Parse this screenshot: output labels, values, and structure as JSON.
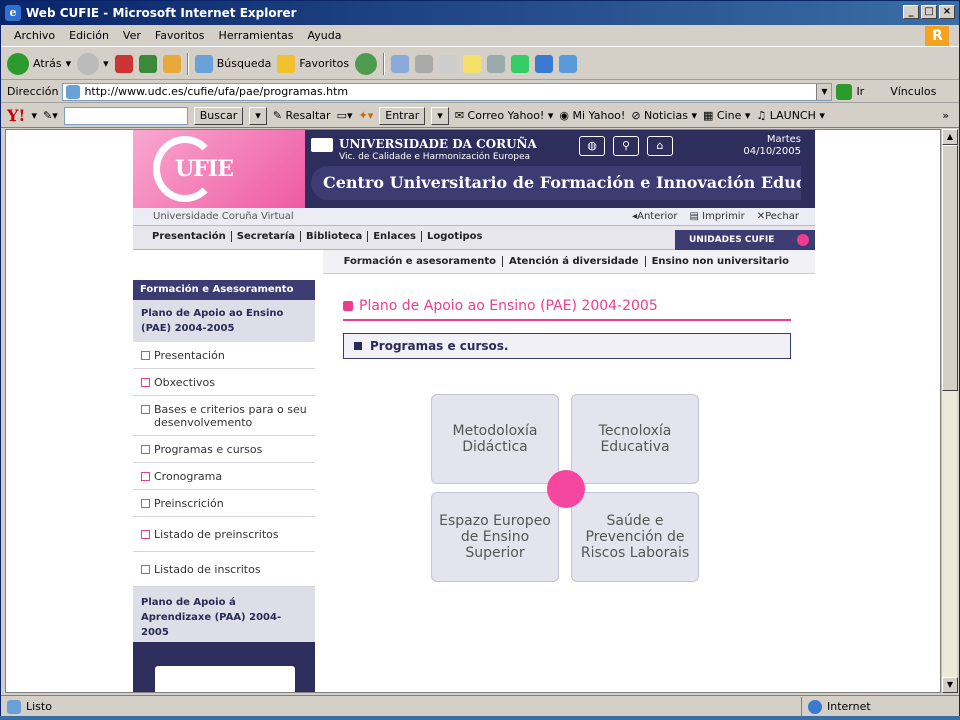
{
  "window": {
    "title": "Web CUFIE - Microsoft Internet Explorer"
  },
  "menu": [
    "Archivo",
    "Edición",
    "Ver",
    "Favoritos",
    "Herramientas",
    "Ayuda"
  ],
  "toolbar": {
    "back": "Atrás",
    "search": "Búsqueda",
    "favorites": "Favoritos"
  },
  "address": {
    "label": "Dirección",
    "url": "http://www.udc.es/cufie/ufa/pae/programas.htm",
    "go": "Ir",
    "links": "Vínculos"
  },
  "yahoo": {
    "logo": "Y!",
    "buscar": "Buscar",
    "resaltar": "Resaltar",
    "entrar": "Entrar",
    "correo": "Correo Yahoo!",
    "mi": "Mi Yahoo!",
    "noticias": "Noticias",
    "cine": "Cine",
    "launch": "LAUNCH"
  },
  "banner": {
    "logo": "UFIE",
    "univ": "UNIVERSIDADE DA CORUÑA",
    "vic": "Vic. de Calidade e Harmonización Europea",
    "day": "Martes",
    "date": "04/10/2005",
    "center": "Centro Universitario de Formación e Innovación Educativa"
  },
  "subbar": {
    "left": "Universidade Coruña Virtual",
    "anterior": "Anterior",
    "imprimir": "Imprimir",
    "pechar": "Pechar"
  },
  "mainnav": [
    "Presentación",
    "Secretaría",
    "Biblioteca",
    "Enlaces",
    "Logotipos"
  ],
  "unidades": "UNIDADES CUFIE",
  "unitnav": [
    "Formación e asesoramento",
    "Atención á diversidade",
    "Ensino non universitario"
  ],
  "sidebar": {
    "header": "Formación e Asesoramento",
    "group1": "Plano de Apoio ao Ensino (PAE) 2004-2005",
    "items": [
      "Presentación",
      "Obxectivos",
      "Bases e criterios para o seu desenvolvemento",
      "Programas e cursos",
      "Cronograma",
      "Preinscrición",
      "Listado de preinscritos",
      "Listado de inscritos"
    ],
    "group2": "Plano de Apoio á Aprendizaxe (PAA) 2004-2005"
  },
  "content": {
    "title": "Plano de Apoio ao Ensino (PAE) 2004-2005",
    "section": "Programas e cursos."
  },
  "tiles": [
    "Metodoloxía Didáctica",
    "Tecnoloxía Educativa",
    "Espazo Europeo de Ensino Superior",
    "Saúde e Prevención de Riscos Laborais"
  ],
  "status": {
    "left": "Listo",
    "zone": "Internet"
  }
}
